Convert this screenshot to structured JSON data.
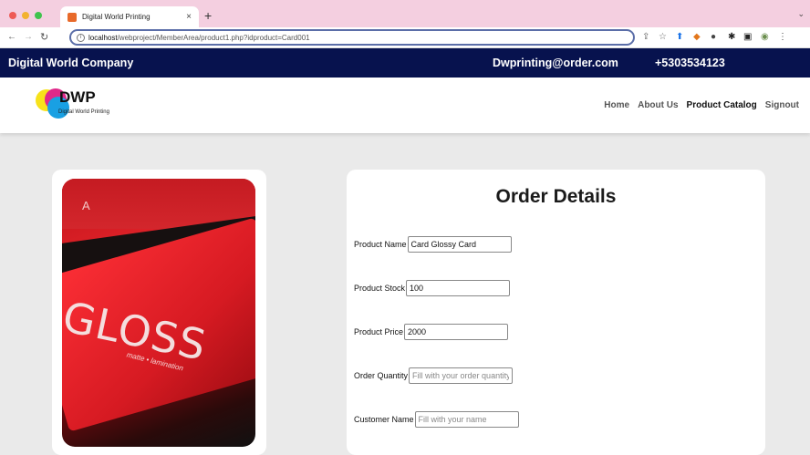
{
  "browser": {
    "tab_title": "Digital World Printing",
    "tab_close": "×",
    "new_tab": "+",
    "url_host": "localhost",
    "url_path": "/webproject/MemberArea/product1.php?idproduct=Card001"
  },
  "header": {
    "company": "Digital World Company",
    "email": "Dwprinting@order.com",
    "phone": "+5303534123"
  },
  "logo": {
    "brand": "DWP",
    "tagline": "Digital World Printing"
  },
  "nav": {
    "items": [
      "Home",
      "About Us",
      "Product Catalog",
      "Signout"
    ],
    "active": "Product Catalog"
  },
  "product_image": {
    "letter": "A",
    "text": "GLOSS",
    "subtext": "matte • lamination"
  },
  "order": {
    "title": "Order Details",
    "fields": [
      {
        "label": "Product Name",
        "value": "Card Glossy Card",
        "placeholder": ""
      },
      {
        "label": "Product Stock",
        "value": "100",
        "placeholder": ""
      },
      {
        "label": "Product Price",
        "value": "2000",
        "placeholder": ""
      },
      {
        "label": "Order Quantity",
        "value": "",
        "placeholder": "Fill with your order quantity"
      },
      {
        "label": "Customer Name",
        "value": "",
        "placeholder": "Fill with your name"
      }
    ]
  },
  "colors": {
    "tabbar": "#f4cfe0",
    "topbar": "#07124e",
    "page_bg": "#eaeaea"
  }
}
